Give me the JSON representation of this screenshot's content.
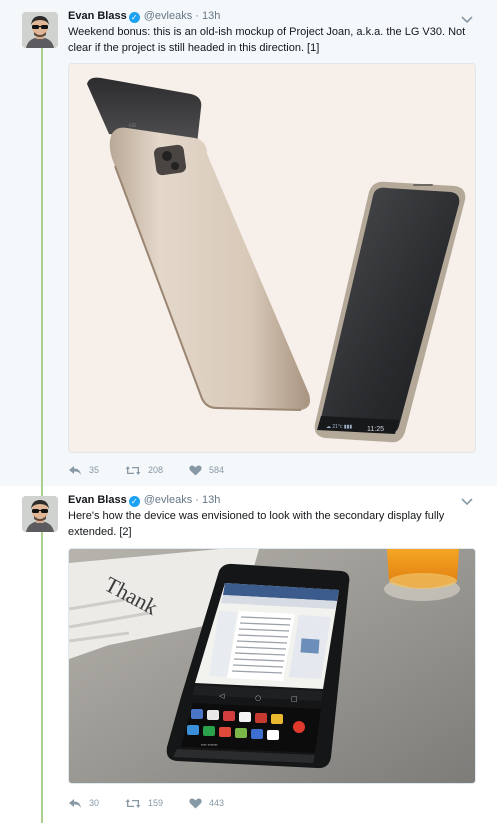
{
  "tweets": [
    {
      "name": "Evan Blass",
      "handle": "@evleaks",
      "separator": "·",
      "time": "13h",
      "text": "Weekend bonus: this is an old-ish mockup of Project Joan, a.k.a. the LG V30. Not clear if the project is still headed in this direction. [1]",
      "media_text": {
        "screen_time": "11:25"
      },
      "actions": {
        "reply": "35",
        "retweet": "208",
        "like": "584"
      }
    },
    {
      "name": "Evan Blass",
      "handle": "@evleaks",
      "separator": "·",
      "time": "13h",
      "text": "Here's how the device was envisioned to look with the secondary display fully extended. [2]",
      "media_text": {
        "paper_word": "Thank"
      },
      "actions": {
        "reply": "30",
        "retweet": "159",
        "like": "443"
      }
    }
  ],
  "icons": {
    "reply": "reply-icon",
    "retweet": "retweet-icon",
    "like": "heart-icon",
    "verified": "verified-badge-icon",
    "caret": "chevron-down-icon"
  },
  "colors": {
    "thread_line": "#a9d08e",
    "verified": "#1da1f2",
    "meta_text": "#657786",
    "action_icons": "#8899a6",
    "background_highlight": "#f5f8fa"
  }
}
